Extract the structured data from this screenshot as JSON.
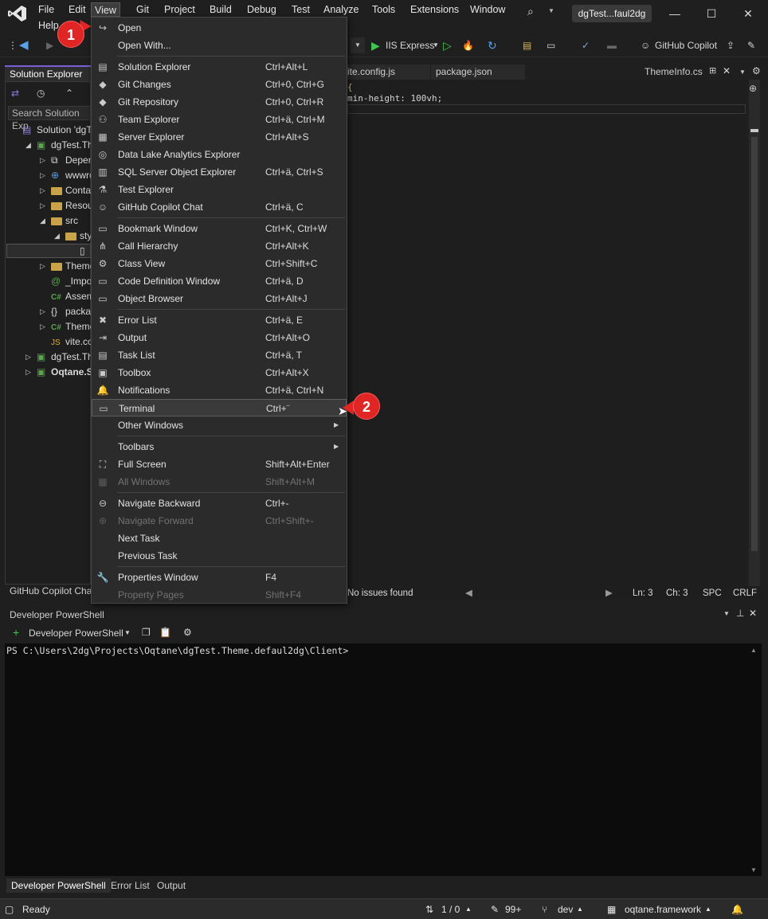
{
  "menubar": {
    "items": [
      "File",
      "Edit",
      "View",
      "Git",
      "Project",
      "Build",
      "Debug",
      "Test",
      "Analyze",
      "Tools",
      "Extensions",
      "Window"
    ],
    "help": "Help",
    "window_title": "dgTest...faul2dg"
  },
  "toolbar": {
    "run_target": "IIS Express",
    "copilot": "GitHub Copilot"
  },
  "solution_explorer": {
    "tab": "Solution Explorer",
    "search_placeholder": "Search Solution Exp",
    "tree": [
      {
        "label": "Solution 'dgT",
        "indent": 0
      },
      {
        "label": "dgTest.Th",
        "indent": 1
      },
      {
        "label": "Depen",
        "indent": 2
      },
      {
        "label": "wwwrc",
        "indent": 2
      },
      {
        "label": "Contai",
        "indent": 2
      },
      {
        "label": "Resour",
        "indent": 2
      },
      {
        "label": "src",
        "indent": 2
      },
      {
        "label": "sty",
        "indent": 3
      },
      {
        "label": "",
        "indent": 4
      },
      {
        "label": "Theme",
        "indent": 2
      },
      {
        "label": "_Impo",
        "indent": 2
      },
      {
        "label": "Assem",
        "indent": 2
      },
      {
        "label": "packag",
        "indent": 2
      },
      {
        "label": "Theme",
        "indent": 2
      },
      {
        "label": "vite.co",
        "indent": 2
      },
      {
        "label": "dgTest.Th",
        "indent": 1
      },
      {
        "label": "Oqtane.S",
        "indent": 1
      }
    ],
    "bottom_tab": "GitHub Copilot Cha"
  },
  "editor": {
    "tabs": [
      "vite.config.js",
      "package.json",
      "ThemeInfo.cs"
    ],
    "code_line1": "{",
    "code_line2": "min-height: 100vh;",
    "issues": "No issues found",
    "ln": "Ln: 3",
    "ch": "Ch: 3",
    "spc": "SPC",
    "crlf": "CRLF"
  },
  "view_menu": {
    "items": [
      {
        "label": "Open",
        "shortcut": "",
        "icon": "redo-icon"
      },
      {
        "label": "Open With...",
        "shortcut": ""
      },
      {
        "sep": true
      },
      {
        "label": "Solution Explorer",
        "shortcut": "Ctrl+Alt+L"
      },
      {
        "label": "Git Changes",
        "shortcut": "Ctrl+0, Ctrl+G"
      },
      {
        "label": "Git Repository",
        "shortcut": "Ctrl+0, Ctrl+R"
      },
      {
        "label": "Team Explorer",
        "shortcut": "Ctrl+ä, Ctrl+M"
      },
      {
        "label": "Server Explorer",
        "shortcut": "Ctrl+Alt+S"
      },
      {
        "label": "Data Lake Analytics Explorer",
        "shortcut": ""
      },
      {
        "label": "SQL Server Object Explorer",
        "shortcut": "Ctrl+ä, Ctrl+S"
      },
      {
        "label": "Test Explorer",
        "shortcut": ""
      },
      {
        "label": "GitHub Copilot Chat",
        "shortcut": "Ctrl+ä, C"
      },
      {
        "sep": true
      },
      {
        "label": "Bookmark Window",
        "shortcut": "Ctrl+K, Ctrl+W"
      },
      {
        "label": "Call Hierarchy",
        "shortcut": "Ctrl+Alt+K"
      },
      {
        "label": "Class View",
        "shortcut": "Ctrl+Shift+C"
      },
      {
        "label": "Code Definition Window",
        "shortcut": "Ctrl+ä, D"
      },
      {
        "label": "Object Browser",
        "shortcut": "Ctrl+Alt+J"
      },
      {
        "sep": true
      },
      {
        "label": "Error List",
        "shortcut": "Ctrl+ä, E"
      },
      {
        "label": "Output",
        "shortcut": "Ctrl+Alt+O"
      },
      {
        "label": "Task List",
        "shortcut": "Ctrl+ä, T"
      },
      {
        "label": "Toolbox",
        "shortcut": "Ctrl+Alt+X"
      },
      {
        "label": "Notifications",
        "shortcut": "Ctrl+ä, Ctrl+N"
      },
      {
        "label": "Terminal",
        "shortcut": "Ctrl+¨",
        "hover": true
      },
      {
        "label": "Other Windows",
        "shortcut": "",
        "submenu": true
      },
      {
        "sep": true
      },
      {
        "label": "Toolbars",
        "shortcut": "",
        "submenu": true
      },
      {
        "label": "Full Screen",
        "shortcut": "Shift+Alt+Enter"
      },
      {
        "label": "All Windows",
        "shortcut": "Shift+Alt+M",
        "disabled": true
      },
      {
        "sep": true
      },
      {
        "label": "Navigate Backward",
        "shortcut": "Ctrl+-"
      },
      {
        "label": "Navigate Forward",
        "shortcut": "Ctrl+Shift+-",
        "disabled": true
      },
      {
        "label": "Next Task",
        "shortcut": ""
      },
      {
        "label": "Previous Task",
        "shortcut": ""
      },
      {
        "sep": true
      },
      {
        "label": "Properties Window",
        "shortcut": "F4"
      },
      {
        "label": "Property Pages",
        "shortcut": "Shift+F4",
        "disabled": true
      }
    ]
  },
  "terminal": {
    "header": "Developer PowerShell",
    "new_button": "Developer PowerShell",
    "prompt": "PS C:\\Users\\2dg\\Projects\\Oqtane\\dgTest.Theme.defaul2dg\\Client>",
    "tabs": [
      "Developer PowerShell",
      "Error List",
      "Output"
    ]
  },
  "statusbar": {
    "ready": "Ready",
    "lines": "1 / 0",
    "edits": "99+",
    "branch": "dev",
    "repo": "oqtane.framework"
  },
  "badges": {
    "one": "1",
    "two": "2"
  }
}
